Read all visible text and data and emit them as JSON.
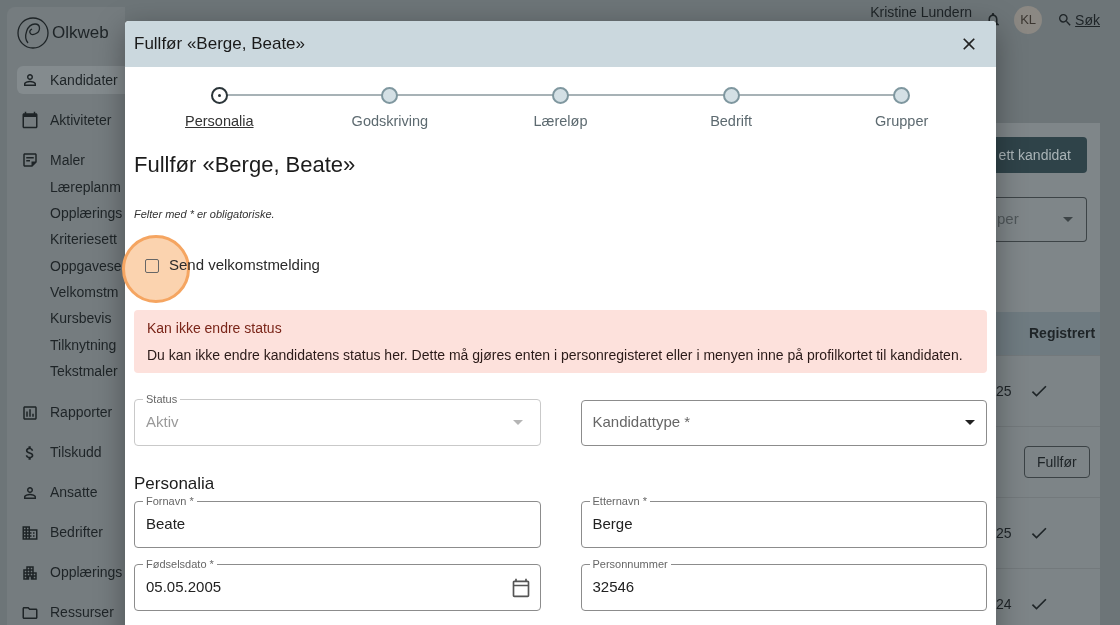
{
  "header": {
    "user_name": "Kristine Lundern",
    "avatar_initials": "KL",
    "search_link": "Søk"
  },
  "sidebar": {
    "logo_text": "Olkweb",
    "items": [
      {
        "label": "Kandidater",
        "selected": true
      },
      {
        "label": "Aktiviteter",
        "selected": false
      },
      {
        "label": "Maler",
        "selected": false,
        "children": [
          {
            "label": "Læreplanm",
            "selected": false
          },
          {
            "label": "Opplærings",
            "selected": false
          },
          {
            "label": "Kriteriesett",
            "selected": false
          },
          {
            "label": "Oppgavese",
            "selected": false
          },
          {
            "label": "Velkomstm",
            "selected": false
          },
          {
            "label": "Kursbevis",
            "selected": false
          },
          {
            "label": "Tilknytning",
            "selected": false
          },
          {
            "label": "Tekstmaler",
            "selected": false
          }
        ]
      },
      {
        "label": "Rapporter",
        "selected": false
      },
      {
        "label": "Tilskudd",
        "selected": false
      },
      {
        "label": "Ansatte",
        "selected": false
      },
      {
        "label": "Bedrifter",
        "selected": false
      },
      {
        "label": "Opplærings",
        "selected": false
      },
      {
        "label": "Ressurser",
        "selected": false
      }
    ]
  },
  "page": {
    "create_button": "ett kandidat",
    "filter_select": "per",
    "table": {
      "columns": [
        "Registrert"
      ],
      "rows": [
        {
          "cell": "25",
          "registered": true
        },
        {
          "registered": false,
          "action": "Fullfør"
        },
        {
          "cell": "25",
          "registered": true
        },
        {
          "cell": "24",
          "registered": true
        }
      ]
    }
  },
  "dialog": {
    "title": "Fullfør «Berge, Beate»",
    "steps": [
      {
        "label": "Personalia",
        "selected": true
      },
      {
        "label": "Godskriving",
        "selected": false
      },
      {
        "label": "Læreløp",
        "selected": false
      },
      {
        "label": "Bedrift",
        "selected": false
      },
      {
        "label": "Grupper",
        "selected": false
      }
    ],
    "heading": "Fullfør «Berge, Beate»",
    "required_note": "Felter med * er obligatoriske.",
    "welcome_checkbox": {
      "label": "Send velkomstmelding",
      "checked": false,
      "highlighted": true
    },
    "alert": {
      "title": "Kan ikke endre status",
      "message": "Du kan ikke endre kandidatens status her. Dette må gjøres enten i personregisteret eller i menyen inne på profilkortet til kandidaten."
    },
    "selects": [
      {
        "label": "Status",
        "value": "Aktiv",
        "disabled": true
      },
      {
        "placeholder": "Kandidattype *",
        "disabled": false
      }
    ],
    "section_title": "Personalia",
    "fields": [
      {
        "label": "Fornavn *",
        "value": "Beate",
        "kind": "text"
      },
      {
        "label": "Etternavn *",
        "value": "Berge",
        "kind": "text"
      },
      {
        "label": "Fødselsdato *",
        "value": "05.05.2005",
        "kind": "date"
      },
      {
        "label": "Personnummer",
        "value": "32546",
        "kind": "text"
      }
    ]
  }
}
